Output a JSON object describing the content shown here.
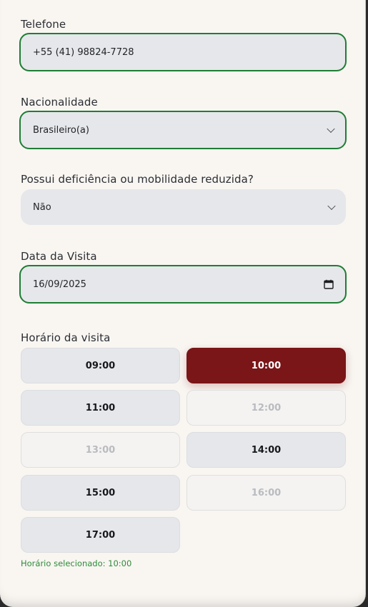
{
  "form": {
    "phone": {
      "label": "Telefone",
      "value": "+55 (41) 98824-7728"
    },
    "nationality": {
      "label": "Nacionalidade",
      "value": "Brasileiro(a)"
    },
    "disability": {
      "label": "Possui deficiência ou mobilidade reduzida?",
      "value": "Não"
    },
    "visit_date": {
      "label": "Data da Visita",
      "value": "16/09/2025"
    },
    "visit_time": {
      "label": "Horário da visita",
      "slots": [
        {
          "time": "09:00",
          "state": "available"
        },
        {
          "time": "10:00",
          "state": "selected"
        },
        {
          "time": "11:00",
          "state": "available"
        },
        {
          "time": "12:00",
          "state": "disabled"
        },
        {
          "time": "13:00",
          "state": "disabled"
        },
        {
          "time": "14:00",
          "state": "available"
        },
        {
          "time": "15:00",
          "state": "available"
        },
        {
          "time": "16:00",
          "state": "disabled"
        },
        {
          "time": "17:00",
          "state": "available"
        }
      ],
      "selected_text": "Horário selecionado: 10:00"
    }
  },
  "colors": {
    "focus_border": "#1e7e34",
    "selected_slot": "#7a1518",
    "confirmation_text": "#2e8b3a",
    "input_bg": "#e6e7ea",
    "page_bg": "#f9f6f2"
  },
  "icons": {
    "select_indicator": "chevron-down-icon",
    "date_picker": "calendar-icon"
  }
}
